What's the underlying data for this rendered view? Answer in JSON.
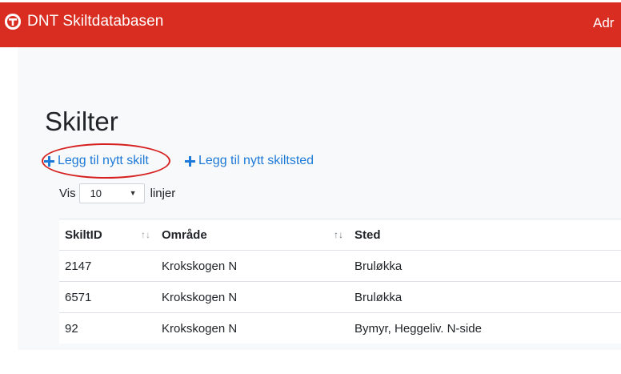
{
  "navbar": {
    "brand": "DNT Skiltdatabasen",
    "right_link": "Adr",
    "colors": {
      "background": "#d82d20"
    },
    "logo_icon": "dnt-logo-icon"
  },
  "page": {
    "title": "Skilter"
  },
  "actions": {
    "add_sign": "Legg til nytt skilt",
    "add_sign_location": "Legg til nytt skiltsted",
    "icon": "plus-icon",
    "link_color": "#1e7ad8"
  },
  "length": {
    "prefix": "Vis",
    "selected": "10",
    "suffix": "linjer"
  },
  "table": {
    "columns": [
      "SkiltID",
      "Område",
      "Sted"
    ],
    "rows": [
      [
        "2147",
        "Krokskogen N",
        "Bruløkka"
      ],
      [
        "6571",
        "Krokskogen N",
        "Bruløkka"
      ],
      [
        "92",
        "Krokskogen N",
        "Bymyr, Heggeliv. N-side"
      ]
    ]
  }
}
